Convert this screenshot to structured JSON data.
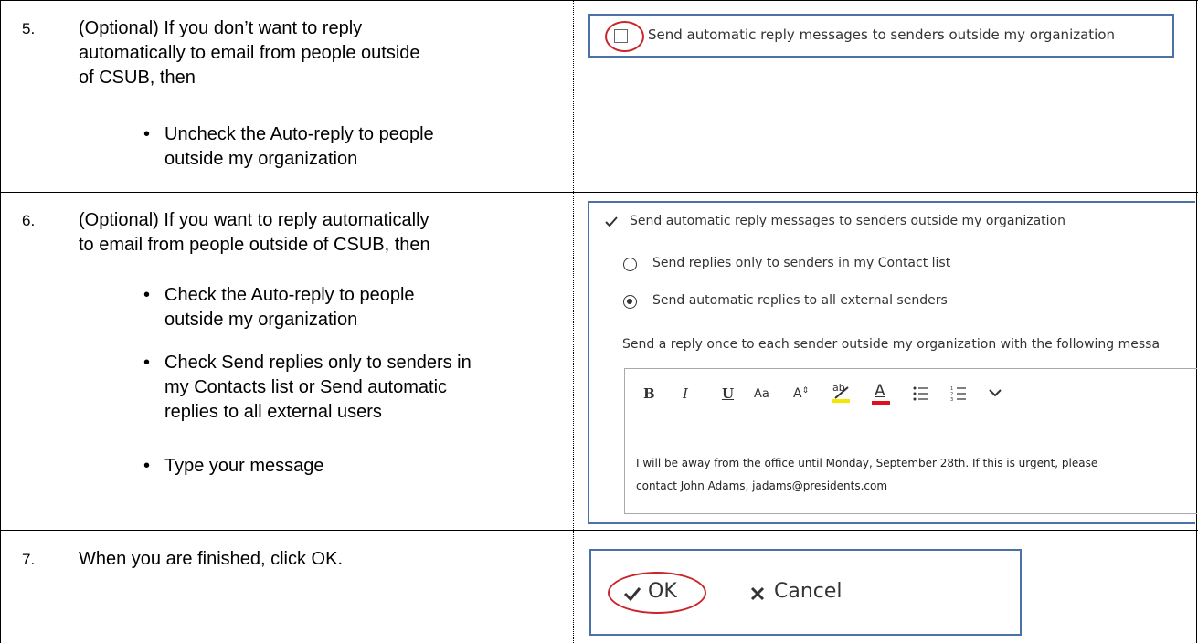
{
  "steps": [
    {
      "number": "5.",
      "lines": [
        "(Optional) If you don’t want to reply",
        "automatically to email from people outside",
        "of CSUB, then"
      ],
      "bullets": [
        [
          "Uncheck the Auto-reply to people",
          "outside my organization"
        ]
      ]
    },
    {
      "number": "6.",
      "lines": [
        "(Optional) If you want to reply automatically",
        "to email from people outside of CSUB, then"
      ],
      "bullets": [
        [
          "Check the Auto-reply to people",
          "outside my organization"
        ],
        [
          "Check Send replies only to senders in",
          "my Contacts list or Send automatic",
          "replies to all external users"
        ],
        [
          "Type your message"
        ]
      ]
    },
    {
      "number": "7.",
      "lines": [
        "When you are finished, click OK."
      ],
      "bullets": []
    }
  ],
  "pane5": {
    "checkbox_label": "Send automatic reply messages to senders outside my organization"
  },
  "pane6": {
    "checkbox_label": "Send automatic reply messages to senders outside my organization",
    "radio_contacts": "Send replies only to senders in my Contact list",
    "radio_all": "Send automatic replies to all external senders",
    "once_text": "Send a reply once to each sender outside my organization with the following messa",
    "toolbar": {
      "bold": "B",
      "italic": "I",
      "underline": "U",
      "font_size": "Aa",
      "grow": "A",
      "highlight": "ab",
      "font_color": "A"
    },
    "message_line1": "I will be away from the office until Monday, September 28th.  If this is urgent, please",
    "message_line2": "contact John Adams, jadams@presidents.com"
  },
  "pane7": {
    "ok_label": "OK",
    "cancel_label": "Cancel"
  },
  "colors": {
    "border_blue": "#4a72a8",
    "annotation_red": "#c9252b",
    "highlight_yellow": "#f5e600",
    "font_red": "#e0101a"
  }
}
